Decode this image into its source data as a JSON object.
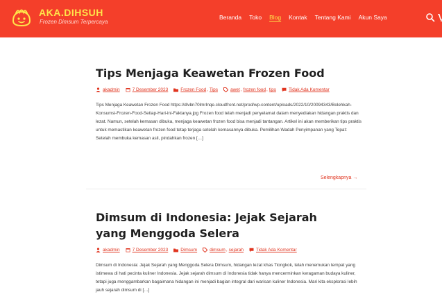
{
  "brand": {
    "name": "AKA.DIHSUH",
    "tagline": "Frozen Dimsum Terpercaya"
  },
  "nav": {
    "items": [
      {
        "label": "Beranda",
        "active": false
      },
      {
        "label": "Toko",
        "active": false
      },
      {
        "label": "Blog",
        "active": true
      },
      {
        "label": "Kontak",
        "active": false
      },
      {
        "label": "Tentang Kami",
        "active": false
      },
      {
        "label": "Akun Saya",
        "active": false
      }
    ],
    "icons": [
      "search-icon",
      "cart-icon"
    ]
  },
  "colors": {
    "header": "#f43f2a",
    "brand": "#ffe44a",
    "link": "#e0341f"
  },
  "posts": [
    {
      "title": "Tips Menjaga Keawetan Frozen Food",
      "author": "akadmin",
      "date": "7 Desember 2023",
      "categories": [
        "Frozen Food",
        "Tips"
      ],
      "tags": [
        "awet",
        "frozen food",
        "tips"
      ],
      "comments": "Tidak Ada Komentar",
      "excerpt": "Tips Menjaga Keawetan Frozen Food https://dlvbn70lmrInqe.cloudfront.net/prod/wp-content/uploads/2022/10/20094343/Bolehkah-Konsumsi-Frozen-Food-Setiap-Hari-ini-Faktanya.jpg Frozen food telah menjadi penyelamat dalam menyediakan hidangan praktis dan lezat. Namun, setelah kemasan dibuka, menjaga keawetan frozen food bisa menjadi tantangan. Artikel ini akan memberikan tips praktis untuk memastikan keawetan frozen food tetap terjaga setelah kemasannya dibuka. Pemilihan Wadah Penyimpanan yang Tepat: Setelah membuka kemasan asli, pindahkan frozen […]",
      "read_more": "Selengkapnya →"
    },
    {
      "title": "Dimsum di Indonesia: Jejak Sejarah yang Menggoda Selera",
      "author": "akadmin",
      "date": "7 Desember 2023",
      "categories": [
        "Dimsum"
      ],
      "tags": [
        "dimsum",
        "sejarah"
      ],
      "comments": "Tidak Ada Komentar",
      "excerpt": "Dimsum di Indonesia: Jejak Sejarah yang Menggoda Selera Dimsum, hidangan lezat khas Tiongkok, telah menemukan tempat yang istimewa di hati pecinta kuliner Indonesia. Jejak sejarah dimsum di Indonesia tidak hanya mencerminkan keragaman budaya kuliner, tetapi juga menggambarkan bagaimana hidangan ini menjadi bagian integral dari warisan kuliner Indonesia. Mari kita eksplorasi lebih jauh sejarah dimsum di […]"
    }
  ]
}
